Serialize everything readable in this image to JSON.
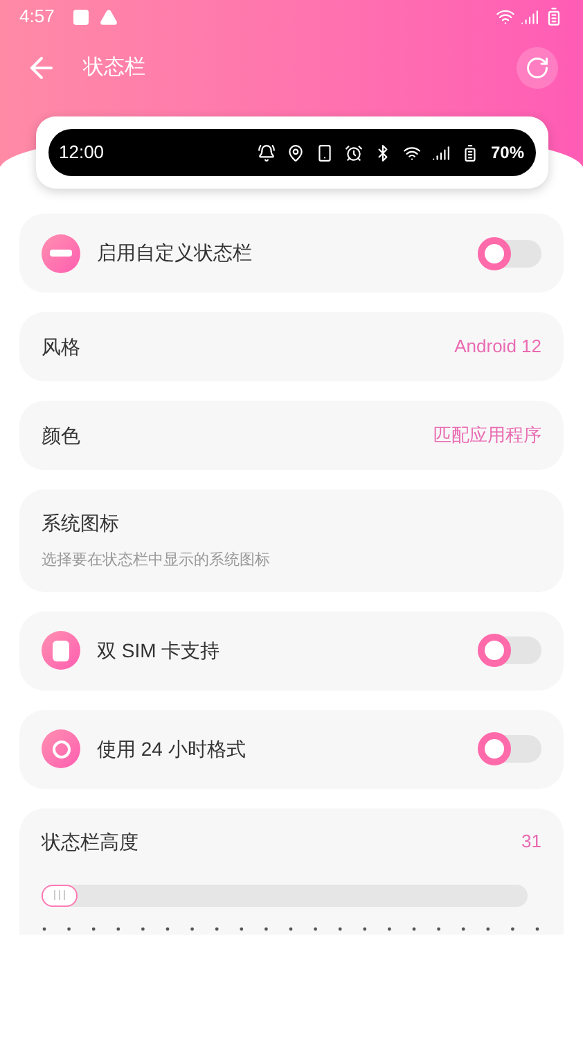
{
  "status_bar": {
    "time": "4:57"
  },
  "header": {
    "title": "状态栏"
  },
  "preview": {
    "time": "12:00",
    "battery": "70%"
  },
  "settings": [
    {
      "kind": "toggle",
      "label": "启用自定义状态栏",
      "checked": false
    },
    {
      "kind": "value",
      "label": "风格",
      "value": "Android 12"
    },
    {
      "kind": "value",
      "label": "颜色",
      "value": "匹配应用程序"
    },
    {
      "kind": "info",
      "label": "系统图标",
      "description": "选择要在状态栏中显示的系统图标"
    },
    {
      "kind": "toggle",
      "label": "双 SIM 卡支持",
      "checked": false
    },
    {
      "kind": "toggle",
      "label": "使用 24 小时格式",
      "checked": false
    },
    {
      "kind": "slider",
      "label": "状态栏高度",
      "value": "31",
      "level": 0.0
    }
  ]
}
